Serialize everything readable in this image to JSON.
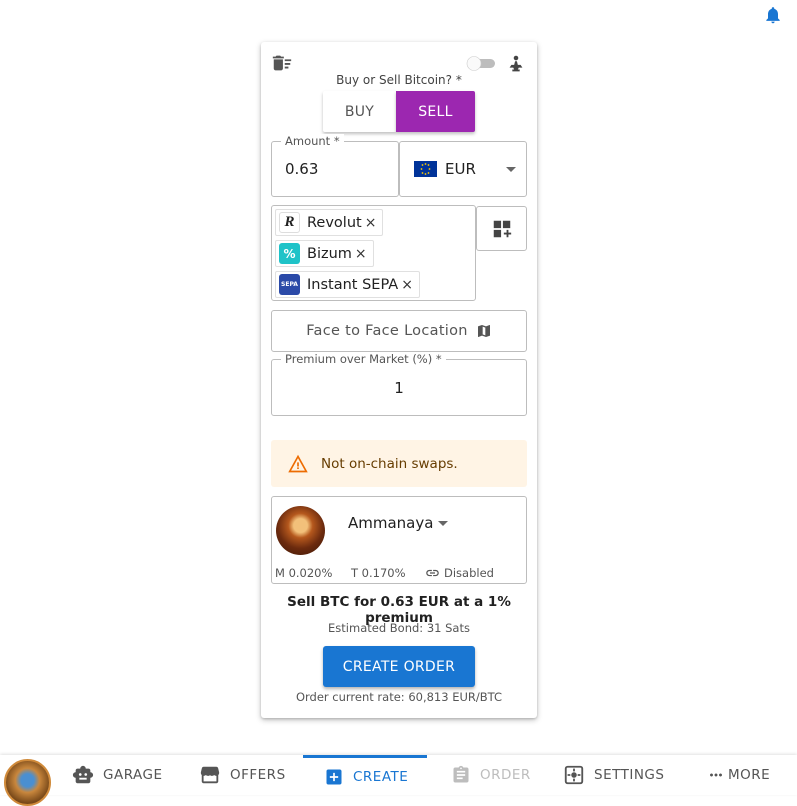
{
  "form": {
    "buysell_label": "Buy or Sell Bitcoin? *",
    "buy_label": "BUY",
    "sell_label": "SELL",
    "amount_label": "Amount *",
    "amount_value": "0.63",
    "currency": "EUR",
    "payment_methods": [
      {
        "label": "Revolut",
        "remove": "×"
      },
      {
        "label": "Bizum",
        "remove": "×"
      },
      {
        "label": "Instant SEPA",
        "remove": "×"
      }
    ],
    "sepa_icon_text": "SEPA",
    "ftf_label": "Face to Face Location",
    "premium_label": "Premium over Market (%) *",
    "premium_value": "1",
    "warning": "Not on-chain swaps.",
    "robot": {
      "name": "Ammanaya",
      "maker_fee": "M 0.020%",
      "taker_fee": "T 0.170%",
      "link_status": "Disabled"
    },
    "summary": "Sell BTC for 0.63 EUR at a 1% premium",
    "bond": "Estimated Bond: 31 Sats",
    "create_label": "CREATE ORDER",
    "rate": "Order current rate: 60,813 EUR/BTC"
  },
  "nav": {
    "garage": "GARAGE",
    "offers": "OFFERS",
    "create": "CREATE",
    "order": "ORDER",
    "settings": "SETTINGS",
    "more": "MORE"
  },
  "colors": {
    "sell": "#9c27b0",
    "primary": "#1976d2",
    "warning_bg": "#fff4e5"
  }
}
